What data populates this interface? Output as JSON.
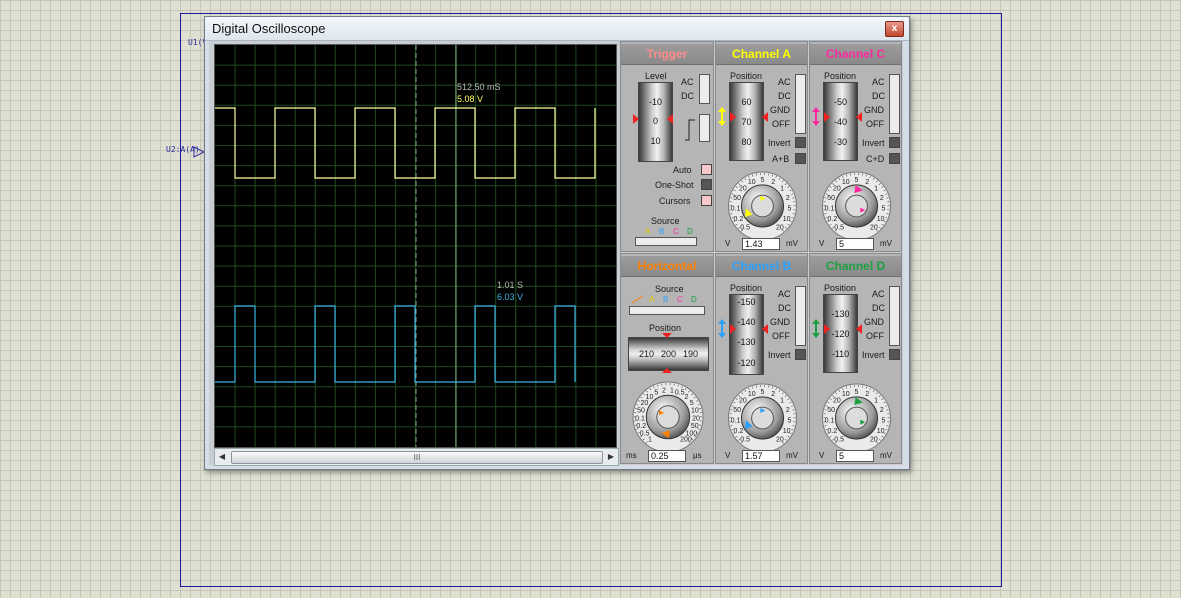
{
  "window": {
    "title": "Digital Oscilloscope",
    "close_glyph": "x"
  },
  "schematic": {
    "net_u1": "U1(V",
    "net_u2": "U2:A(A)"
  },
  "screen": {
    "marker1_time": "512.50 mS",
    "marker1_value": "5.08 V",
    "marker2_time": "1.01 S",
    "marker2_value": "6.03 V"
  },
  "scrollbar": {
    "thumb_grip": "III",
    "left_arrow": "◀",
    "right_arrow": "▶"
  },
  "trigger": {
    "title": "Trigger",
    "level_label": "Level",
    "level_drum": [
      "-10",
      "0",
      "10"
    ],
    "coupling": [
      "AC",
      "DC"
    ],
    "mode_buttons": [
      "Auto",
      "One-Shot",
      "Cursors"
    ],
    "source_label": "Source",
    "source_letters": [
      "A",
      "B",
      "C",
      "D"
    ]
  },
  "horizontal": {
    "title": "Horizontal",
    "source_label": "Source",
    "source_letters": [
      "A",
      "B",
      "C",
      "D"
    ],
    "position_label": "Position",
    "position_drum": [
      "210",
      "200",
      "190"
    ],
    "dial_unit_left": "ms",
    "dial_value": "0.25",
    "dial_unit_right": "μs",
    "dial_scale": [
      "1",
      "0.5",
      "0.2",
      "0.1",
      "50",
      "20",
      "10",
      "5",
      "2",
      "1",
      "0.5",
      "2",
      "5",
      "10",
      "20",
      "50",
      "100",
      "200"
    ]
  },
  "channel_a": {
    "title": "Channel A",
    "position_label": "Position",
    "drum": [
      "60",
      "70",
      "80"
    ],
    "coupling": [
      "AC",
      "DC",
      "GND",
      "OFF"
    ],
    "invert_label": "Invert",
    "combine_label": "A+B",
    "dial_unit_left": "V",
    "dial_value": "1.43",
    "dial_unit_right": "mV",
    "dial_scale": [
      "0.5",
      "0.2",
      "0.1",
      "50",
      "20",
      "10",
      "5",
      "2",
      "1",
      "2",
      "5",
      "10",
      "20"
    ]
  },
  "channel_b": {
    "title": "Channel B",
    "position_label": "Position",
    "drum": [
      "-150",
      "-140",
      "-130",
      "-120"
    ],
    "coupling": [
      "AC",
      "DC",
      "GND",
      "OFF"
    ],
    "invert_label": "Invert",
    "dial_unit_left": "V",
    "dial_value": "1.57",
    "dial_unit_right": "mV",
    "dial_scale": [
      "0.5",
      "0.2",
      "0.1",
      "50",
      "20",
      "10",
      "5",
      "2",
      "1",
      "2",
      "5",
      "10",
      "20"
    ]
  },
  "channel_c": {
    "title": "Channel C",
    "position_label": "Position",
    "drum": [
      "-50",
      "-40",
      "-30"
    ],
    "coupling": [
      "AC",
      "DC",
      "GND",
      "OFF"
    ],
    "invert_label": "Invert",
    "combine_label": "C+D",
    "dial_unit_left": "V",
    "dial_value": "5",
    "dial_unit_right": "mV",
    "dial_scale": [
      "0.5",
      "0.2",
      "0.1",
      "50",
      "20",
      "10",
      "5",
      "2",
      "1",
      "2",
      "5",
      "10",
      "20"
    ]
  },
  "channel_d": {
    "title": "Channel D",
    "position_label": "Position",
    "drum": [
      "-130",
      "-120",
      "-110"
    ],
    "coupling": [
      "AC",
      "DC",
      "GND",
      "OFF"
    ],
    "invert_label": "Invert",
    "dial_unit_left": "V",
    "dial_value": "5",
    "dial_unit_right": "mV",
    "dial_scale": [
      "0.5",
      "0.2",
      "0.1",
      "50",
      "20",
      "10",
      "5",
      "2",
      "1",
      "2",
      "5",
      "10",
      "20"
    ]
  },
  "colors": {
    "channel_a": "#ffff00",
    "channel_b": "#2aa0ff",
    "channel_c": "#ff2aa0",
    "channel_d": "#1aa040",
    "trigger": "#ff8c8c",
    "horizontal": "#ff8000",
    "trace_a": "#ffffa0",
    "trace_b": "#3cb4e6",
    "grid": "#1f4a1f"
  }
}
